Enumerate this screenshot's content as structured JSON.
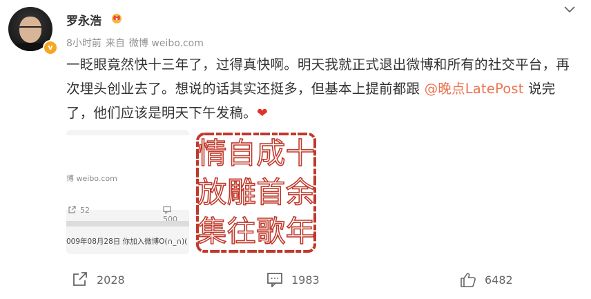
{
  "header": {
    "username": "罗永浩",
    "time": "8小时前",
    "source_prefix": "来自",
    "source": "微博 weibo.com",
    "verified_badge": "v"
  },
  "post": {
    "text_1": "一眨眼竟然快十三年了，过得真快啊。明天我就正式退出微博和所有的社交平台，再次埋头创业去了。想说的话其实还挺多，但基本上提前都跟 ",
    "mention": "@晚点LatePost",
    "text_2": " 说完了，他们应该是明天下午发稿。",
    "emoji": "❤"
  },
  "thumbnail_1": {
    "source_text": "博 weibo.com",
    "repost_count": "52",
    "comment_count": "500",
    "date_text": "009年08月28日 你加入微博O(∩_∩)("
  },
  "thumbnail_2": {
    "seal_chars": [
      "十",
      "余",
      "年",
      "成",
      "首",
      "歌",
      "自",
      "雕",
      "往",
      "情",
      "放",
      "集"
    ]
  },
  "actions": {
    "repost_count": "2028",
    "comment_count": "1983",
    "like_count": "6482"
  },
  "colors": {
    "mention": "#eb7350",
    "meta": "#939393",
    "seal_red": "#c0392b"
  },
  "icons": [
    "crown-icon",
    "chevron-down-icon",
    "repost-icon",
    "comment-icon",
    "like-icon",
    "heart-icon"
  ]
}
